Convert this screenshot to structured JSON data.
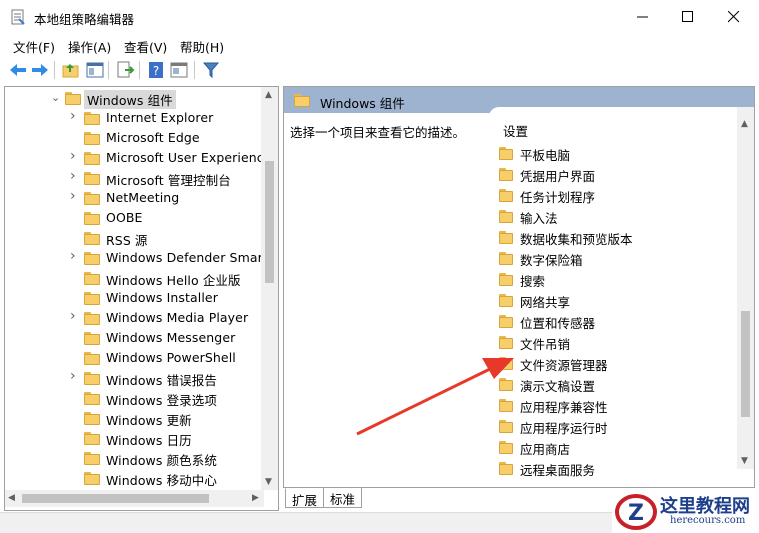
{
  "window": {
    "title": "本地组策略编辑器"
  },
  "menu": {
    "items": [
      "文件(F)",
      "操作(A)",
      "查看(V)",
      "帮助(H)"
    ]
  },
  "tree": {
    "parent": "Windows 组件",
    "items": [
      {
        "label": "Internet Explorer",
        "expandable": true
      },
      {
        "label": "Microsoft Edge",
        "expandable": false
      },
      {
        "label": "Microsoft User Experience",
        "expandable": true
      },
      {
        "label": "Microsoft 管理控制台",
        "expandable": true
      },
      {
        "label": "NetMeeting",
        "expandable": true
      },
      {
        "label": "OOBE",
        "expandable": false
      },
      {
        "label": "RSS 源",
        "expandable": false
      },
      {
        "label": "Windows Defender SmartS",
        "expandable": true
      },
      {
        "label": "Windows Hello 企业版",
        "expandable": false
      },
      {
        "label": "Windows Installer",
        "expandable": false
      },
      {
        "label": "Windows Media Player",
        "expandable": true
      },
      {
        "label": "Windows Messenger",
        "expandable": false
      },
      {
        "label": "Windows PowerShell",
        "expandable": false
      },
      {
        "label": "Windows 错误报告",
        "expandable": true
      },
      {
        "label": "Windows 登录选项",
        "expandable": false
      },
      {
        "label": "Windows 更新",
        "expandable": false
      },
      {
        "label": "Windows 日历",
        "expandable": false
      },
      {
        "label": "Windows 颜色系统",
        "expandable": false
      },
      {
        "label": "Windows 移动中心",
        "expandable": false
      }
    ]
  },
  "right": {
    "header_title": "Windows 组件",
    "description": "选择一个项目来查看它的描述。",
    "list_header": "设置",
    "items": [
      "平板电脑",
      "凭据用户界面",
      "任务计划程序",
      "输入法",
      "数据收集和预览版本",
      "数字保险箱",
      "搜索",
      "网络共享",
      "位置和传感器",
      "文件吊销",
      "文件资源管理器",
      "演示文稿设置",
      "应用程序兼容性",
      "应用程序运行时",
      "应用商店",
      "远程桌面服务"
    ]
  },
  "tabs": [
    "扩展",
    "标准"
  ],
  "watermark": {
    "title": "这里教程网",
    "url": "herecours.com"
  },
  "colors": {
    "header_bg": "#9eb3cf",
    "annotation": "#e8382a",
    "folder": "#f6cf6a"
  }
}
